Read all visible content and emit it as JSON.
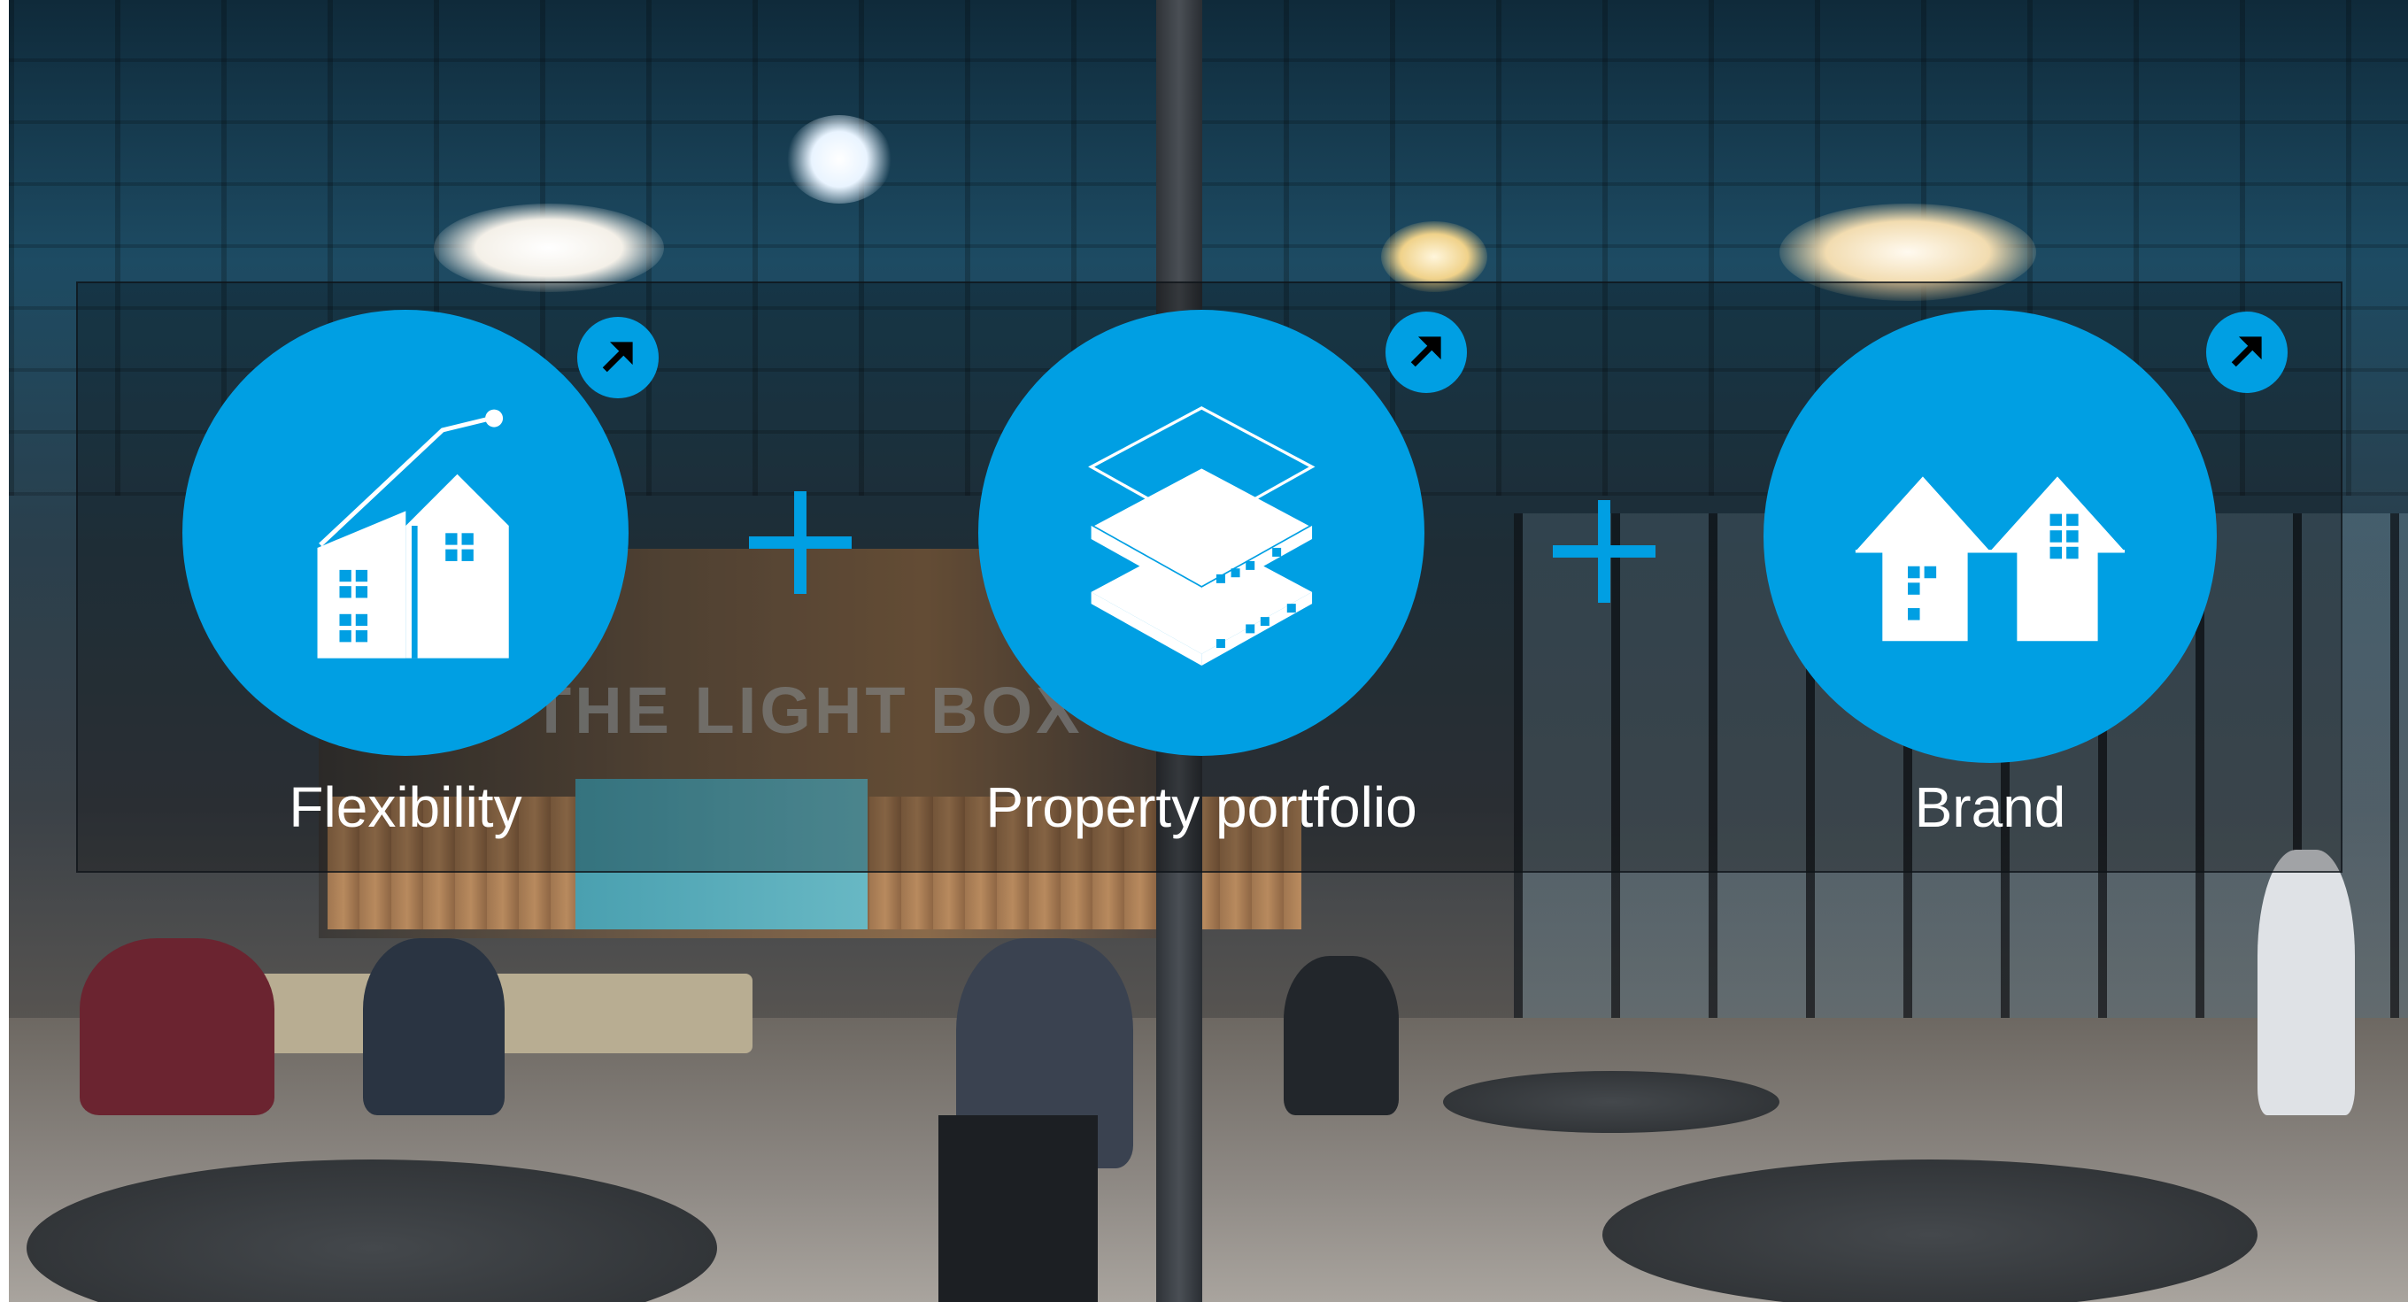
{
  "background": {
    "sign": "THE LIGHT BOX"
  },
  "features": [
    {
      "label": "Flexibility",
      "icon": "growth-house-icon"
    },
    {
      "label": "Property portfolio",
      "icon": "layered-buildings-icon"
    },
    {
      "label": "Brand",
      "icon": "twin-houses-icon"
    }
  ],
  "colors": {
    "accent": "#009fe3",
    "text": "#ffffff"
  }
}
